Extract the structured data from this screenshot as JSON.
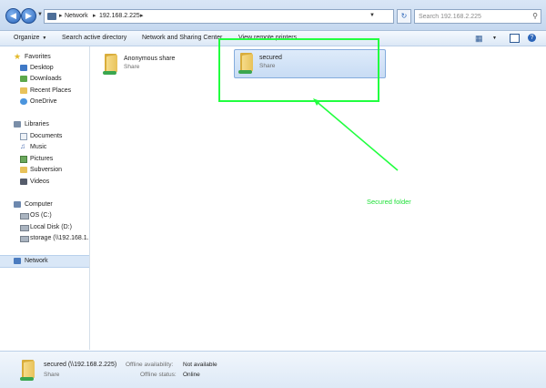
{
  "address": {
    "crumbs": [
      "Network",
      "192.168.2.225"
    ],
    "search_placeholder": "Search 192.168.2.225"
  },
  "toolbar": {
    "organize": "Organize",
    "search_ad": "Search active directory",
    "network_sharing": "Network and Sharing Center",
    "view_printers": "View remote printers"
  },
  "navigation": {
    "favorites": "Favorites",
    "desktop": "Desktop",
    "downloads": "Downloads",
    "recent": "Recent Places",
    "onedrive": "OneDrive",
    "libraries": "Libraries",
    "documents": "Documents",
    "music": "Music",
    "pictures": "Pictures",
    "subversion": "Subversion",
    "videos": "Videos",
    "computer": "Computer",
    "os_c": "OS (C:)",
    "local_d": "Local Disk (D:)",
    "storage": "storage (\\\\192.168.1.",
    "network": "Network"
  },
  "content": {
    "items": [
      {
        "name": "Anonymous share",
        "type": "Share"
      },
      {
        "name": "secured",
        "type": "Share"
      }
    ]
  },
  "annotation": {
    "label": "Secured folder",
    "color": "#21ff3f"
  },
  "details": {
    "name": "secured (\\\\192.168.2.225)",
    "type": "Share",
    "offline_availability_label": "Offline availability:",
    "offline_availability_value": "Not available",
    "offline_status_label": "Offline status:",
    "offline_status_value": "Online"
  },
  "colors": {
    "accent": "#2a64b8",
    "selection": "#c8dcf4",
    "folder": "#e8c25a"
  }
}
